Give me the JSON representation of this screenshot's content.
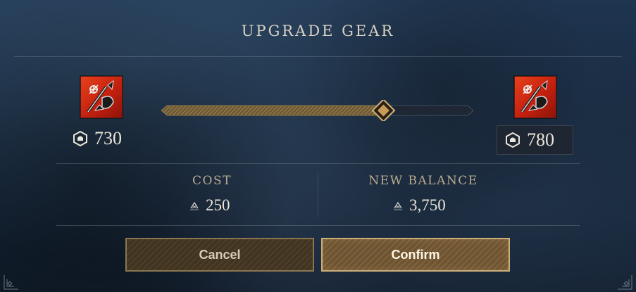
{
  "dialog": {
    "title": "UPGRADE GEAR"
  },
  "current": {
    "gear_score": "730",
    "icon": "crossbow-weapon-icon"
  },
  "target": {
    "gear_score": "780",
    "icon": "crossbow-weapon-icon"
  },
  "slider": {
    "level": 0.72
  },
  "cost": {
    "label": "COST",
    "value": "250",
    "icon": "azoth-currency-icon"
  },
  "new_balance": {
    "label": "NEW BALANCE",
    "value": "3,750",
    "icon": "azoth-currency-icon"
  },
  "buttons": {
    "cancel": "Cancel",
    "confirm": "Confirm"
  },
  "colors": {
    "accent_gold": "#cbb07a",
    "item_rarity_red": "#d62f14",
    "text_light": "#ece6d8"
  }
}
